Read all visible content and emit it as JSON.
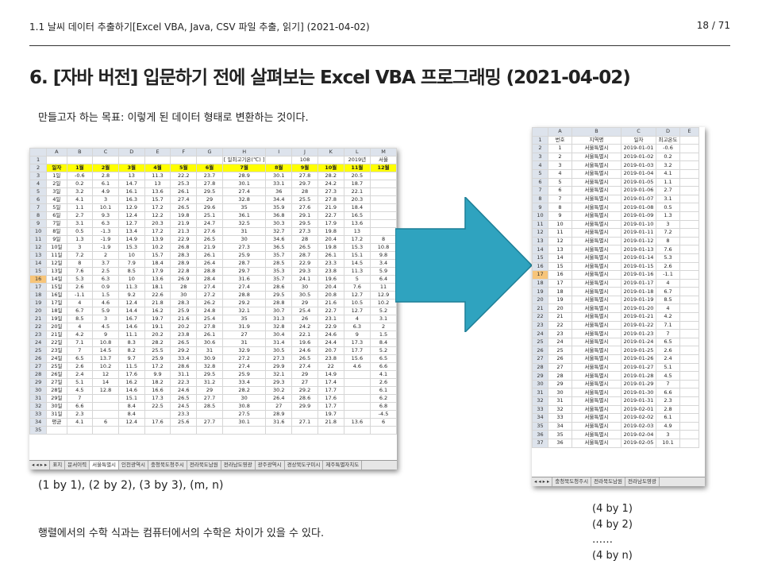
{
  "header": {
    "left": "1.1 날씨 데이터 추출하기[Excel VBA, Java, CSV 파일 추출, 읽기] (2021-04-02)",
    "page": "18 / 71"
  },
  "title": "6. [자바 버전] 입문하기 전에 살펴보는 Excel VBA 프로그래밍 (2021-04-02)",
  "goal_text": "만들고자 하는 목표: 이렇게 된 데이터 형태로 변환하는 것이다.",
  "pairs_text": "(1 by 1), (2 by 2), (3 by 3), (m, n)",
  "note_text": "행렬에서의 수학 식과는 컴퓨터에서의 수학은 차이가 있을 수 있다.",
  "right_lines": [
    "(4 by 1)",
    "(4 by 2)",
    "……",
    "(4 by n)"
  ],
  "left_sheet": {
    "col_headers": [
      "",
      "A",
      "B",
      "C",
      "D",
      "E",
      "F",
      "G",
      "H",
      "I",
      "J",
      "K",
      "L",
      "M"
    ],
    "rows": [
      [
        "1",
        "",
        "",
        "",
        "",
        "",
        "",
        "",
        "[ 일최고기온(℃) ]",
        "",
        "108",
        "",
        "2019년",
        "서울"
      ],
      [
        "2",
        "일자",
        "1월",
        "2월",
        "3월",
        "4월",
        "5월",
        "6월",
        "7월",
        "8월",
        "9월",
        "10월",
        "11월",
        "12월"
      ],
      [
        "3",
        "1일",
        "-0.6",
        "2.8",
        "13",
        "11.3",
        "22.2",
        "23.7",
        "28.9",
        "30.1",
        "27.8",
        "28.2",
        "20.5",
        ""
      ],
      [
        "4",
        "2일",
        "0.2",
        "6.1",
        "14.7",
        "13",
        "25.3",
        "27.8",
        "30.1",
        "33.1",
        "29.7",
        "24.2",
        "18.7",
        ""
      ],
      [
        "5",
        "3일",
        "3.2",
        "4.9",
        "16.1",
        "13.6",
        "26.1",
        "29.5",
        "27.4",
        "36",
        "28",
        "27.3",
        "22.1",
        ""
      ],
      [
        "6",
        "4일",
        "4.1",
        "3",
        "16.3",
        "15.7",
        "27.4",
        "29",
        "32.8",
        "34.4",
        "25.5",
        "27.8",
        "20.3",
        ""
      ],
      [
        "7",
        "5일",
        "1.1",
        "10.1",
        "12.9",
        "17.2",
        "26.5",
        "29.6",
        "35",
        "35.9",
        "27.6",
        "21.9",
        "18.4",
        ""
      ],
      [
        "8",
        "6일",
        "2.7",
        "9.3",
        "12.4",
        "12.2",
        "19.8",
        "25.1",
        "36.1",
        "36.8",
        "29.1",
        "22.7",
        "16.5",
        ""
      ],
      [
        "9",
        "7일",
        "3.1",
        "6.3",
        "12.7",
        "20.3",
        "21.9",
        "24.7",
        "32.5",
        "30.3",
        "29.5",
        "17.9",
        "13.6",
        ""
      ],
      [
        "10",
        "8일",
        "0.5",
        "-1.3",
        "13.4",
        "17.2",
        "21.3",
        "27.6",
        "31",
        "32.7",
        "27.3",
        "19.8",
        "13",
        ""
      ],
      [
        "11",
        "9일",
        "1.3",
        "-1.9",
        "14.9",
        "13.9",
        "22.9",
        "26.5",
        "30",
        "34.6",
        "28",
        "20.4",
        "17.2",
        "8"
      ],
      [
        "12",
        "10일",
        "3",
        "-1.9",
        "15.3",
        "10.2",
        "26.8",
        "21.9",
        "27.3",
        "36.5",
        "26.5",
        "19.8",
        "15.3",
        "10.8"
      ],
      [
        "13",
        "11일",
        "7.2",
        "2",
        "10",
        "15.7",
        "28.3",
        "26.1",
        "25.9",
        "35.7",
        "28.7",
        "26.1",
        "15.1",
        "9.8"
      ],
      [
        "14",
        "12일",
        "8",
        "3.7",
        "7.9",
        "18.4",
        "28.9",
        "26.4",
        "28.7",
        "28.5",
        "22.9",
        "23.3",
        "14.5",
        "3.4"
      ],
      [
        "15",
        "13일",
        "7.6",
        "2.5",
        "8.5",
        "17.9",
        "22.8",
        "28.8",
        "29.7",
        "35.3",
        "29.3",
        "23.8",
        "11.3",
        "5.9"
      ],
      [
        "16",
        "14일",
        "5.3",
        "6.3",
        "10",
        "13.6",
        "26.9",
        "28.4",
        "31.6",
        "35.7",
        "24.1",
        "19.6",
        "5",
        "6.4"
      ],
      [
        "17",
        "15일",
        "2.6",
        "0.9",
        "11.3",
        "18.1",
        "28",
        "27.4",
        "27.4",
        "28.6",
        "30",
        "20.4",
        "7.6",
        "11"
      ],
      [
        "18",
        "16일",
        "-1.1",
        "1.5",
        "9.2",
        "22.6",
        "30",
        "27.2",
        "28.8",
        "29.5",
        "30.5",
        "20.8",
        "12.7",
        "12.9"
      ],
      [
        "19",
        "17일",
        "4",
        "4.6",
        "12.4",
        "21.8",
        "28.3",
        "26.2",
        "29.2",
        "28.8",
        "29",
        "21.6",
        "10.5",
        "10.2"
      ],
      [
        "20",
        "18일",
        "6.7",
        "5.9",
        "14.4",
        "16.2",
        "25.9",
        "24.8",
        "32.1",
        "30.7",
        "25.4",
        "22.7",
        "12.7",
        "5.2"
      ],
      [
        "21",
        "19일",
        "8.5",
        "3",
        "16.7",
        "19.7",
        "21.6",
        "25.4",
        "35",
        "31.3",
        "26",
        "23.1",
        "4",
        "3.1"
      ],
      [
        "22",
        "20일",
        "4",
        "4.5",
        "14.6",
        "19.1",
        "20.2",
        "27.8",
        "31.9",
        "32.8",
        "24.2",
        "22.9",
        "6.3",
        "2"
      ],
      [
        "23",
        "21일",
        "4.2",
        "9",
        "11.1",
        "20.2",
        "23.8",
        "26.1",
        "27",
        "30.4",
        "22.1",
        "24.6",
        "9",
        "1.5"
      ],
      [
        "24",
        "22일",
        "7.1",
        "10.8",
        "8.3",
        "28.2",
        "26.5",
        "30.6",
        "31",
        "31.4",
        "19.6",
        "24.4",
        "17.3",
        "8.4"
      ],
      [
        "25",
        "23일",
        "7",
        "14.5",
        "8.2",
        "25.5",
        "29.2",
        "31",
        "32.9",
        "30.5",
        "24.6",
        "20.7",
        "17.7",
        "5.2"
      ],
      [
        "26",
        "24일",
        "6.5",
        "13.7",
        "9.7",
        "25.9",
        "33.4",
        "30.9",
        "27.2",
        "27.3",
        "26.5",
        "23.8",
        "15.6",
        "6.5"
      ],
      [
        "27",
        "25일",
        "2.6",
        "10.2",
        "11.5",
        "17.2",
        "28.6",
        "32.8",
        "27.4",
        "29.9",
        "27.4",
        "22",
        "4.6",
        "6.6"
      ],
      [
        "28",
        "26일",
        "2.4",
        "12",
        "17.6",
        "9.9",
        "31.1",
        "29.5",
        "25.9",
        "32.1",
        "29",
        "14.9",
        "",
        "4.1"
      ],
      [
        "29",
        "27일",
        "5.1",
        "14",
        "16.2",
        "18.2",
        "22.3",
        "31.2",
        "33.4",
        "29.3",
        "27",
        "17.4",
        "",
        "2.6"
      ],
      [
        "30",
        "28일",
        "4.5",
        "12.8",
        "14.6",
        "16.6",
        "24.6",
        "29",
        "28.2",
        "30.2",
        "29.2",
        "17.7",
        "",
        "6.1"
      ],
      [
        "31",
        "29일",
        "7",
        "",
        "15.1",
        "17.3",
        "26.5",
        "27.7",
        "30",
        "26.4",
        "28.6",
        "17.6",
        "",
        "6.2"
      ],
      [
        "32",
        "30일",
        "6.6",
        "",
        "8.4",
        "22.5",
        "24.5",
        "28.5",
        "30.8",
        "27",
        "29.9",
        "17.7",
        "",
        "6.8"
      ],
      [
        "33",
        "31일",
        "2.3",
        "",
        "8.4",
        "",
        "23.3",
        "",
        "27.5",
        "28.9",
        "",
        "19.7",
        "",
        "-4.5"
      ],
      [
        "34",
        "평균",
        "4.1",
        "6",
        "12.4",
        "17.6",
        "25.6",
        "27.7",
        "30.1",
        "31.6",
        "27.1",
        "21.8",
        "13.6",
        "6"
      ],
      [
        "35",
        "",
        "",
        "",
        "",
        "",
        "",
        "",
        "",
        "",
        "",
        "",
        "",
        ""
      ]
    ],
    "tabs": [
      "표지",
      "문서이력",
      "서울특별시",
      "인천광역시",
      "충청북도청주시",
      "전라북도남원",
      "전라남도영광",
      "광주광역시",
      "경상북도구미시",
      "제주특별자치도"
    ]
  },
  "right_sheet": {
    "col_headers": [
      "",
      "A",
      "B",
      "C",
      "D",
      "E"
    ],
    "rows": [
      [
        "1",
        "번호",
        "지역명",
        "일자",
        "최고온도",
        ""
      ],
      [
        "2",
        "1",
        "서울특별시",
        "2019-01-01",
        "-0.6",
        ""
      ],
      [
        "3",
        "2",
        "서울특별시",
        "2019-01-02",
        "0.2",
        ""
      ],
      [
        "4",
        "3",
        "서울특별시",
        "2019-01-03",
        "3.2",
        ""
      ],
      [
        "5",
        "4",
        "서울특별시",
        "2019-01-04",
        "4.1",
        ""
      ],
      [
        "6",
        "5",
        "서울특별시",
        "2019-01-05",
        "1.1",
        ""
      ],
      [
        "7",
        "6",
        "서울특별시",
        "2019-01-06",
        "2.7",
        ""
      ],
      [
        "8",
        "7",
        "서울특별시",
        "2019-01-07",
        "3.1",
        ""
      ],
      [
        "9",
        "8",
        "서울특별시",
        "2019-01-08",
        "0.5",
        ""
      ],
      [
        "10",
        "9",
        "서울특별시",
        "2019-01-09",
        "1.3",
        ""
      ],
      [
        "11",
        "10",
        "서울특별시",
        "2019-01-10",
        "3",
        ""
      ],
      [
        "12",
        "11",
        "서울특별시",
        "2019-01-11",
        "7.2",
        ""
      ],
      [
        "13",
        "12",
        "서울특별시",
        "2019-01-12",
        "8",
        ""
      ],
      [
        "14",
        "13",
        "서울특별시",
        "2019-01-13",
        "7.6",
        ""
      ],
      [
        "15",
        "14",
        "서울특별시",
        "2019-01-14",
        "5.3",
        ""
      ],
      [
        "16",
        "15",
        "서울특별시",
        "2019-01-15",
        "2.6",
        ""
      ],
      [
        "17",
        "16",
        "서울특별시",
        "2019-01-16",
        "-1.1",
        ""
      ],
      [
        "18",
        "17",
        "서울특별시",
        "2019-01-17",
        "4",
        ""
      ],
      [
        "19",
        "18",
        "서울특별시",
        "2019-01-18",
        "6.7",
        ""
      ],
      [
        "20",
        "19",
        "서울특별시",
        "2019-01-19",
        "8.5",
        ""
      ],
      [
        "21",
        "20",
        "서울특별시",
        "2019-01-20",
        "4",
        ""
      ],
      [
        "22",
        "21",
        "서울특별시",
        "2019-01-21",
        "4.2",
        ""
      ],
      [
        "23",
        "22",
        "서울특별시",
        "2019-01-22",
        "7.1",
        ""
      ],
      [
        "24",
        "23",
        "서울특별시",
        "2019-01-23",
        "7",
        ""
      ],
      [
        "25",
        "24",
        "서울특별시",
        "2019-01-24",
        "6.5",
        ""
      ],
      [
        "26",
        "25",
        "서울특별시",
        "2019-01-25",
        "2.6",
        ""
      ],
      [
        "27",
        "26",
        "서울특별시",
        "2019-01-26",
        "2.4",
        ""
      ],
      [
        "28",
        "27",
        "서울특별시",
        "2019-01-27",
        "5.1",
        ""
      ],
      [
        "29",
        "28",
        "서울특별시",
        "2019-01-28",
        "4.5",
        ""
      ],
      [
        "30",
        "29",
        "서울특별시",
        "2019-01-29",
        "7",
        ""
      ],
      [
        "31",
        "30",
        "서울특별시",
        "2019-01-30",
        "6.6",
        ""
      ],
      [
        "32",
        "31",
        "서울특별시",
        "2019-01-31",
        "2.3",
        ""
      ],
      [
        "33",
        "32",
        "서울특별시",
        "2019-02-01",
        "2.8",
        ""
      ],
      [
        "34",
        "33",
        "서울특별시",
        "2019-02-02",
        "6.1",
        ""
      ],
      [
        "35",
        "34",
        "서울특별시",
        "2019-02-03",
        "4.9",
        ""
      ],
      [
        "36",
        "35",
        "서울특별시",
        "2019-02-04",
        "3",
        ""
      ],
      [
        "37",
        "36",
        "서울특별시",
        "2019-02-05",
        "10.1",
        ""
      ]
    ],
    "tabs": [
      "충청북도청주시",
      "전라북도남원",
      "전라남도영광"
    ]
  },
  "colors": {
    "arrow": "#2fa3bf",
    "arrow_edge": "#1d7f97",
    "highlight": "#ffff00",
    "header_bg": "#dde3ec"
  }
}
